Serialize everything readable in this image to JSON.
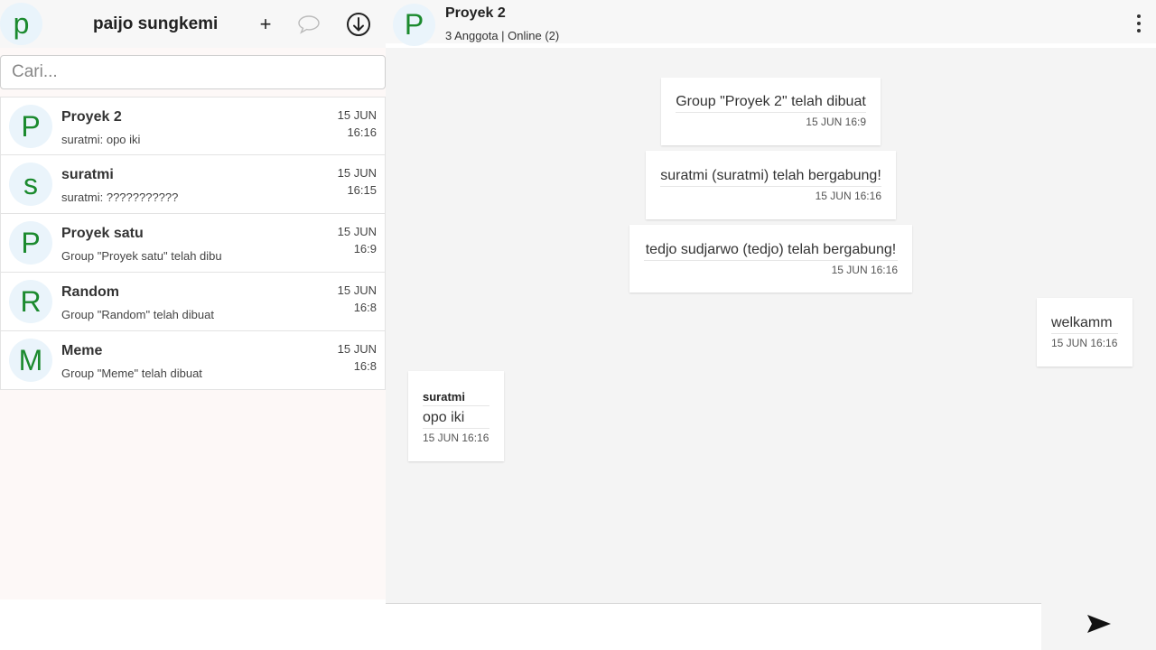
{
  "user": {
    "initial": "p",
    "name": "paijo sungkemi"
  },
  "header_icons": [
    "plus-icon",
    "chat-bubble-icon",
    "download-icon"
  ],
  "search": {
    "placeholder": "Cari...",
    "value": ""
  },
  "chats": [
    {
      "initial": "P",
      "name": "Proyek 2",
      "last": "suratmi: opo iki",
      "date": "15 JUN",
      "time": "16:16"
    },
    {
      "initial": "s",
      "name": "suratmi",
      "last": "suratmi: ???????????",
      "date": "15 JUN",
      "time": "16:15"
    },
    {
      "initial": "P",
      "name": "Proyek satu",
      "last": "Group \"Proyek satu\" telah dibu",
      "date": "15 JUN",
      "time": "16:9"
    },
    {
      "initial": "R",
      "name": "Random",
      "last": "Group \"Random\" telah dibuat",
      "date": "15 JUN",
      "time": "16:8"
    },
    {
      "initial": "M",
      "name": "Meme",
      "last": "Group \"Meme\" telah dibuat",
      "date": "15 JUN",
      "time": "16:8"
    }
  ],
  "conversation": {
    "initial": "P",
    "title": "Proyek 2",
    "subtitle": "3 Anggota | Online (2)",
    "messages": [
      {
        "kind": "system",
        "text": "Group \"Proyek 2\" telah dibuat",
        "time": "15 JUN 16:9"
      },
      {
        "kind": "system",
        "text": "suratmi (suratmi) telah bergabung!",
        "time": "15 JUN 16:16"
      },
      {
        "kind": "system",
        "text": "tedjo sudjarwo (tedjo) telah bergabung!",
        "time": "15 JUN 16:16"
      },
      {
        "kind": "outgoing",
        "text": "welkamm",
        "time": "15 JUN 16:16"
      },
      {
        "kind": "incoming",
        "sender": "suratmi",
        "text": "opo iki",
        "time": "15 JUN 16:16"
      }
    ]
  },
  "composer": {
    "placeholder": "",
    "value": ""
  },
  "colors": {
    "avatar_letter": "#1b8a2e",
    "avatar_bg": "#eaf4fb",
    "chat_bg": "#f4f4f4",
    "sidebar_bg": "#fdf8f7"
  }
}
